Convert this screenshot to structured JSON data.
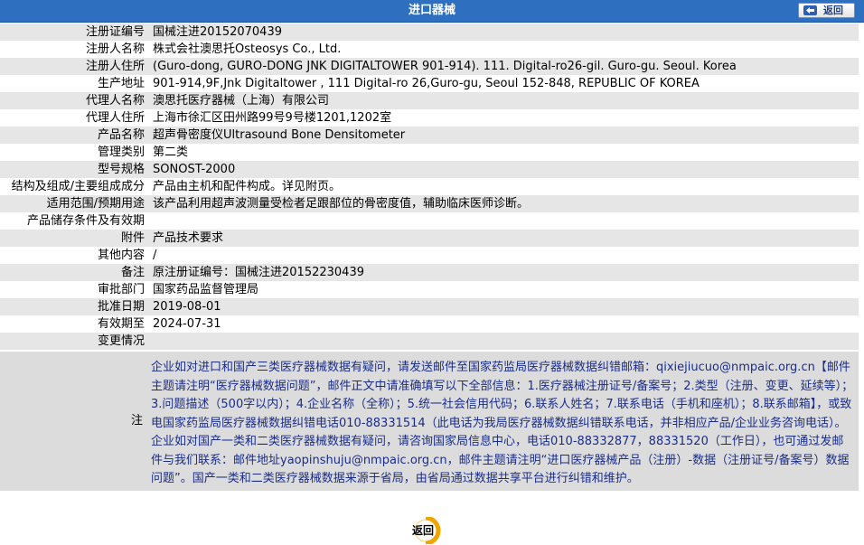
{
  "header": {
    "title": "进口器械",
    "back_label": "返回"
  },
  "rows": [
    {
      "label": "注册证编号",
      "value": "国械注进20152070439"
    },
    {
      "label": "注册人名称",
      "value": "株式会社澳思托Osteosys Co., Ltd."
    },
    {
      "label": "注册人住所",
      "value": "(Guro-dong, GURO-DONG JNK DIGITALTOWER 901-914). 111. Digital-ro26-gil. Guro-gu. Seoul. Korea"
    },
    {
      "label": "生产地址",
      "value": "901-914,9F,Jnk Digitaltower , 111 Digital-ro 26,Guro-gu, Seoul 152-848, REPUBLIC OF KOREA"
    },
    {
      "label": "代理人名称",
      "value": "澳思托医疗器械（上海）有限公司"
    },
    {
      "label": "代理人住所",
      "value": "上海市徐汇区田州路99号9号楼1201,1202室"
    },
    {
      "label": "产品名称",
      "value": "超声骨密度仪Ultrasound Bone Densitometer"
    },
    {
      "label": "管理类别",
      "value": "第二类"
    },
    {
      "label": "型号规格",
      "value": "SONOST-2000"
    },
    {
      "label": "结构及组成/主要组成成分",
      "value": "产品由主机和配件构成。详见附页。"
    },
    {
      "label": "适用范围/预期用途",
      "value": "该产品利用超声波测量受检者足跟部位的骨密度值，辅助临床医师诊断。"
    },
    {
      "label": "产品储存条件及有效期",
      "value": ""
    },
    {
      "label": "附件",
      "value": "产品技术要求"
    },
    {
      "label": "其他内容",
      "value": "/"
    },
    {
      "label": "备注",
      "value": "原注册证编号：国械注进20152230439"
    },
    {
      "label": "审批部门",
      "value": "国家药品监督管理局"
    },
    {
      "label": "批准日期",
      "value": "2019-08-01"
    },
    {
      "label": "有效期至",
      "value": "2024-07-31"
    },
    {
      "label": "变更情况",
      "value": ""
    }
  ],
  "note": {
    "label": "注",
    "text": "企业如对进口和国产三类医疗器械数据有疑问，请发送邮件至国家药监局医疗器械数据纠错邮箱：qixiejiucuo@nmpaic.org.cn【邮件主题请注明“医疗器械数据问题”，邮件正文中请准确填写以下全部信息：1.医疗器械注册证号/备案号；2.类型（注册、变更、延续等）；3.问题描述（500字以内）；4.企业名称（全称）；5.统一社会信用代码；6.联系人姓名；7.联系电话（手机和座机）；8.联系邮箱】，或致电国家药监局医疗器械数据纠错电话010-88331514（此电话为我局医疗器械数据纠错联系电话，并非相应产品/企业业务咨询电话）。企业如对国产一类和二类医疗器械数据有疑问，请咨询国家局信息中心，电话010-88332877，88331520（工作日），也可通过发邮件与我们联系：邮件地址yaopinshuju@nmpaic.org.cn，邮件主题请注明“进口医疗器械产品（注册）-数据（注册证号/备案号）数据问题”。国产一类和二类医疗器械数据来源于省局，由省局通过数据共享平台进行纠错和维护。"
  },
  "footer": {
    "back_label": "返回"
  }
}
